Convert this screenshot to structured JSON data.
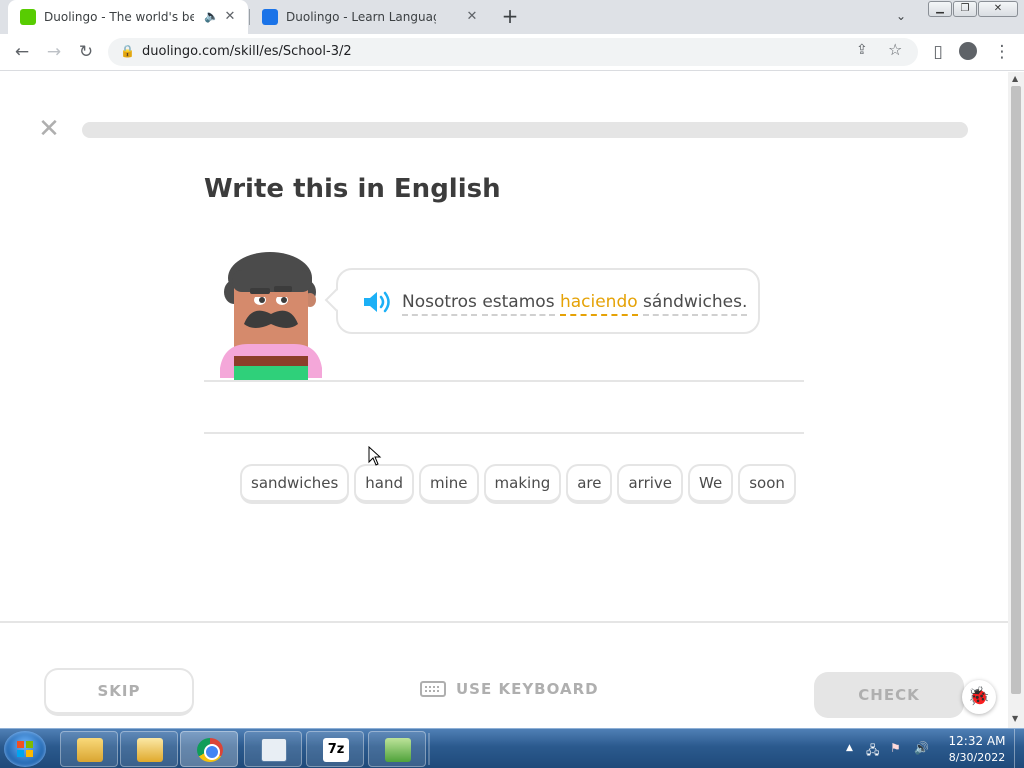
{
  "browser": {
    "tabs": [
      {
        "title": "Duolingo - The world's best",
        "active": true,
        "favicon_color": "#58cc02"
      },
      {
        "title": "Duolingo - Learn Languages for Fr",
        "active": false,
        "favicon_color": "#1a73e8"
      }
    ],
    "address": {
      "host": "duolingo.com",
      "path": "/skill/es/School-3/2"
    }
  },
  "lesson": {
    "progress_percent": 0,
    "prompt_title": "Write this in English",
    "sentence_tokens": [
      {
        "text": "Nosotros",
        "new": false
      },
      {
        "text": "estamos",
        "new": false
      },
      {
        "text": "haciendo",
        "new": true
      },
      {
        "text": "sándwiches.",
        "new": false
      }
    ],
    "word_bank": [
      "sandwiches",
      "hand",
      "mine",
      "making",
      "are",
      "arrive",
      "We",
      "soon"
    ]
  },
  "footer": {
    "skip_label": "SKIP",
    "keyboard_label": "USE KEYBOARD",
    "check_label": "CHECK"
  },
  "taskbar": {
    "time": "12:32 AM",
    "date": "8/30/2022",
    "seven_zip_label": "7z"
  },
  "colors": {
    "new_word": "#e5a206",
    "speaker": "#1cb0f6",
    "border": "#e5e5e5",
    "disabled_text": "#afafaf"
  }
}
